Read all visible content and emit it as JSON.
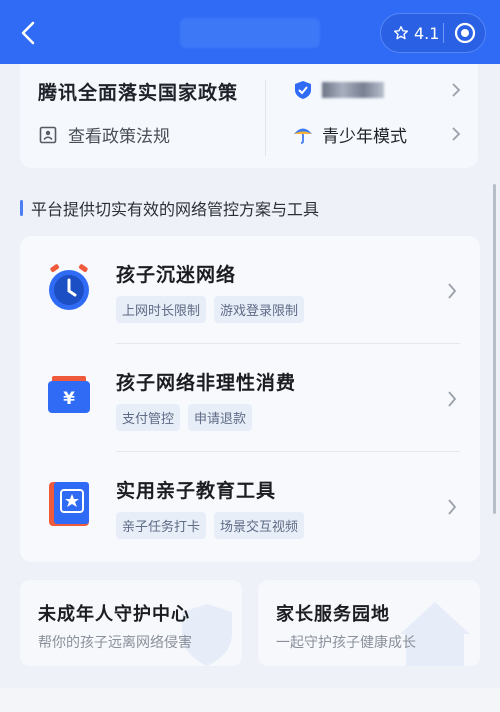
{
  "topbar": {
    "rating": "4.1"
  },
  "policy": {
    "title": "腾讯全面落实国家政策",
    "sub": "查看政策法规",
    "right_mode": "青少年模式"
  },
  "section_title": "平台提供切实有效的网络管控方案与工具",
  "rows": [
    {
      "title": "孩子沉迷网络",
      "tags": [
        "上网时长限制",
        "游戏登录限制"
      ]
    },
    {
      "title": "孩子网络非理性消费",
      "tags": [
        "支付管控",
        "申请退款"
      ]
    },
    {
      "title": "实用亲子教育工具",
      "tags": [
        "亲子任务打卡",
        "场景交互视频"
      ]
    }
  ],
  "bottom_cards": [
    {
      "title": "未成年人守护中心",
      "sub": "帮你的孩子远离网络侵害"
    },
    {
      "title": "家长服务园地",
      "sub": "一起守护孩子健康成长"
    }
  ],
  "colors": {
    "primary": "#2f6bf5",
    "icon_red": "#ef5a3b",
    "tag_bg": "#e8eef8"
  }
}
